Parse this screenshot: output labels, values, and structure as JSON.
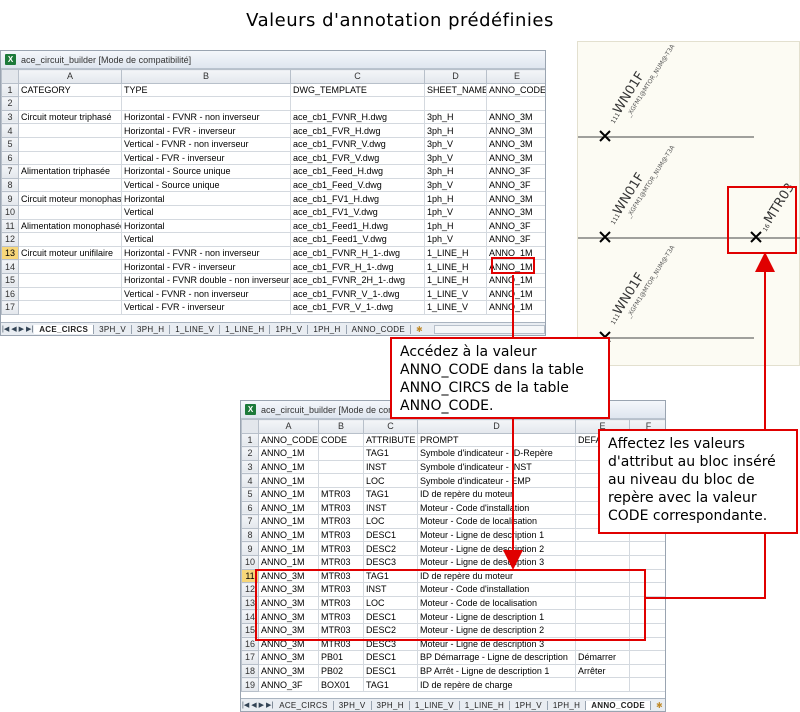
{
  "page_title": "Valeurs d'annotation prédéfinies",
  "sheet1": {
    "window_title": "ace_circuit_builder  [Mode de compatibilité]",
    "col_headers": [
      "A",
      "B",
      "C",
      "D",
      "E"
    ],
    "rows": [
      [
        "CATEGORY",
        "TYPE",
        "DWG_TEMPLATE",
        "SHEET_NAME",
        "ANNO_CODE"
      ],
      [
        "",
        "",
        "",
        "",
        ""
      ],
      [
        "Circuit moteur triphasé",
        "Horizontal - FVNR - non inverseur",
        "ace_cb1_FVNR_H.dwg",
        "3ph_H",
        "ANNO_3M"
      ],
      [
        "",
        "Horizontal - FVR - inverseur",
        "ace_cb1_FVR_H.dwg",
        "3ph_H",
        "ANNO_3M"
      ],
      [
        "",
        "Vertical - FVNR - non inverseur",
        "ace_cb1_FVNR_V.dwg",
        "3ph_V",
        "ANNO_3M"
      ],
      [
        "",
        "Vertical - FVR - inverseur",
        "ace_cb1_FVR_V.dwg",
        "3ph_V",
        "ANNO_3M"
      ],
      [
        "Alimentation triphasée",
        "Horizontal - Source unique",
        "ace_cb1_Feed_H.dwg",
        "3ph_H",
        "ANNO_3F"
      ],
      [
        "",
        "Vertical - Source unique",
        "ace_cb1_Feed_V.dwg",
        "3ph_V",
        "ANNO_3F"
      ],
      [
        "Circuit moteur monophasé",
        "Horizontal",
        "ace_cb1_FV1_H.dwg",
        "1ph_H",
        "ANNO_3M"
      ],
      [
        "",
        "Vertical",
        "ace_cb1_FV1_V.dwg",
        "1ph_V",
        "ANNO_3M"
      ],
      [
        "Alimentation monophasée",
        "Horizontal",
        "ace_cb1_Feed1_H.dwg",
        "1ph_H",
        "ANNO_3F"
      ],
      [
        "",
        "Vertical",
        "ace_cb1_Feed1_V.dwg",
        "1ph_V",
        "ANNO_3F"
      ],
      [
        "Circuit moteur unifilaire",
        "Horizontal - FVNR - non inverseur",
        "ace_cb1_FVNR_H_1-.dwg",
        "1_LINE_H",
        "ANNO_1M"
      ],
      [
        "",
        "Horizontal - FVR - inverseur",
        "ace_cb1_FVR_H_1-.dwg",
        "1_LINE_H",
        "ANNO_1M"
      ],
      [
        "",
        "Horizontal - FVNR double - non inverseur",
        "ace_cb1_FVNR_2H_1-.dwg",
        "1_LINE_H",
        "ANNO_1M"
      ],
      [
        "",
        "Vertical - FVNR - non inverseur",
        "ace_cb1_FVNR_V_1-.dwg",
        "1_LINE_V",
        "ANNO_1M"
      ],
      [
        "",
        "Vertical - FVR - inverseur",
        "ace_cb1_FVR_V_1-.dwg",
        "1_LINE_V",
        "ANNO_1M"
      ]
    ],
    "selected_row": "13",
    "tabs": [
      "ACE_CIRCS",
      "3PH_V",
      "3PH_H",
      "1_LINE_V",
      "1_LINE_H",
      "1PH_V",
      "1PH_H",
      "ANNO_CODE"
    ],
    "active_tab": "ACE_CIRCS"
  },
  "sheet2": {
    "window_title": "ace_circuit_builder  [Mode de compatibilité]",
    "col_headers": [
      "A",
      "B",
      "C",
      "D",
      "E",
      "F"
    ],
    "rows": [
      [
        "ANNO_CODE",
        "CODE",
        "ATTRIBUTE",
        "PROMPT",
        "DEFAULT",
        ""
      ],
      [
        "ANNO_1M",
        "",
        "TAG1",
        "Symbole d'indicateur - ID-Repère",
        "",
        ""
      ],
      [
        "ANNO_1M",
        "",
        "INST",
        "Symbole d'indicateur - INST",
        "",
        ""
      ],
      [
        "ANNO_1M",
        "",
        "LOC",
        "Symbole d'indicateur - EMP",
        "",
        ""
      ],
      [
        "ANNO_1M",
        "MTR03",
        "TAG1",
        "ID de repère du moteur",
        "",
        ""
      ],
      [
        "ANNO_1M",
        "MTR03",
        "INST",
        "Moteur - Code d'installation",
        "",
        ""
      ],
      [
        "ANNO_1M",
        "MTR03",
        "LOC",
        "Moteur - Code de localisation",
        "",
        ""
      ],
      [
        "ANNO_1M",
        "MTR03",
        "DESC1",
        "Moteur - Ligne de description 1",
        "",
        ""
      ],
      [
        "ANNO_1M",
        "MTR03",
        "DESC2",
        "Moteur - Ligne de description 2",
        "",
        ""
      ],
      [
        "ANNO_1M",
        "MTR03",
        "DESC3",
        "Moteur - Ligne de description 3",
        "",
        ""
      ],
      [
        "ANNO_3M",
        "MTR03",
        "TAG1",
        "ID de repère du moteur",
        "",
        ""
      ],
      [
        "ANNO_3M",
        "MTR03",
        "INST",
        "Moteur - Code d'installation",
        "",
        ""
      ],
      [
        "ANNO_3M",
        "MTR03",
        "LOC",
        "Moteur - Code de localisation",
        "",
        ""
      ],
      [
        "ANNO_3M",
        "MTR03",
        "DESC1",
        "Moteur - Ligne de description 1",
        "",
        ""
      ],
      [
        "ANNO_3M",
        "MTR03",
        "DESC2",
        "Moteur - Ligne de description 2",
        "",
        ""
      ],
      [
        "ANNO_3M",
        "MTR03",
        "DESC3",
        "Moteur - Ligne de description 3",
        "",
        ""
      ],
      [
        "ANNO_3M",
        "PB01",
        "DESC1",
        "BP Démarrage - Ligne de description",
        "Démarrer",
        ""
      ],
      [
        "ANNO_3M",
        "PB02",
        "DESC1",
        "BP Arrêt - Ligne de description 1",
        "Arrêter",
        ""
      ],
      [
        "ANNO_3F",
        "BOX01",
        "TAG1",
        "ID de repère de charge",
        "",
        ""
      ]
    ],
    "selected_row": "11",
    "tabs": [
      "ACE_CIRCS",
      "3PH_V",
      "3PH_H",
      "1_LINE_V",
      "1_LINE_H",
      "1PH_V",
      "1PH_H",
      "ANNO_CODE"
    ],
    "active_tab": "ANNO_CODE"
  },
  "callout1": "Accédez à la valeur ANNO_CODE dans la table ANNO_CIRCS de la table ANNO_CODE.",
  "callout2": "Affectez les valeurs d'attribut au bloc inséré au niveau du bloc de repère avec la valeur CODE correspondante.",
  "cad": {
    "labels": [
      {
        "tag": "WN01F",
        "prefix": "111",
        "sub": "_XGFM1@MTOR_NUM@-T3A"
      },
      {
        "tag": "WN01F",
        "prefix": "111",
        "sub": "_XGFM1@MTOR_NUM@-T3A"
      },
      {
        "tag": "WN01F",
        "prefix": "111",
        "sub": "_XGFM1@MTOR_NUM@-T3A"
      }
    ],
    "highlight_label": {
      "tag": "MTR03",
      "prefix": "16"
    }
  },
  "colors": {
    "callout_red": "#e00000",
    "excel_green": "#1d7a3a",
    "selected_row_header": "#f7d77a"
  }
}
